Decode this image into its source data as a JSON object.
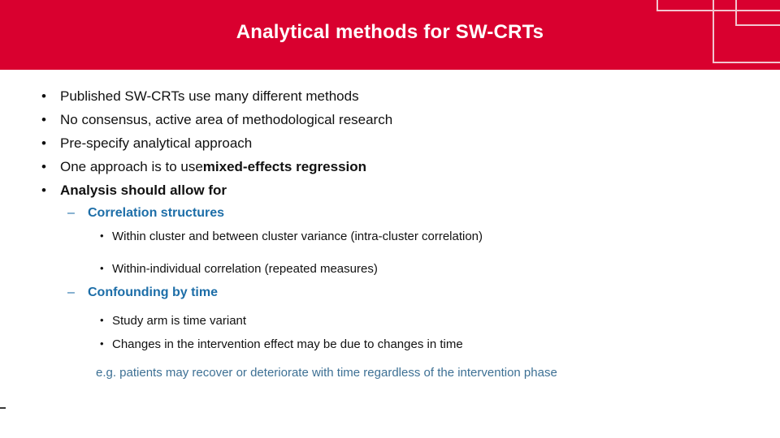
{
  "slide": {
    "title": "Analytical methods for SW-CRTs",
    "accent_red": "#d9002f",
    "heading_blue": "#1d6ea8",
    "note_blue": "#3d7094",
    "body_black": "#111111",
    "deco_line_color": "#f2c4cf"
  },
  "bullets": {
    "marker_level1": "•",
    "marker_level2": "–",
    "marker_level3": "•",
    "level1": [
      {
        "text": "Published SW-CRTs use many different methods",
        "bold": false
      },
      {
        "text": "No consensus, active area of methodological research",
        "bold": false
      },
      {
        "text": "Pre-specify analytical approach",
        "bold": false
      },
      {
        "text": "One approach is to use ",
        "bold_tail": "mixed-effects regression",
        "bold": false
      },
      {
        "text": "Analysis should allow for",
        "bold": true
      }
    ],
    "level2": [
      {
        "text": "Correlation structures"
      },
      {
        "text": "Confounding by time"
      }
    ],
    "level3_correlation": [
      {
        "text": "Within cluster and between cluster variance (intra-cluster correlation)"
      },
      {
        "text": "Within-individual correlation (repeated measures)"
      }
    ],
    "level3_confounding": [
      {
        "text": "Study arm is time variant"
      },
      {
        "text": "Changes in the intervention effect may be due to changes in time"
      }
    ],
    "note": "e.g. patients may recover or deteriorate with time regardless of the intervention phase"
  }
}
